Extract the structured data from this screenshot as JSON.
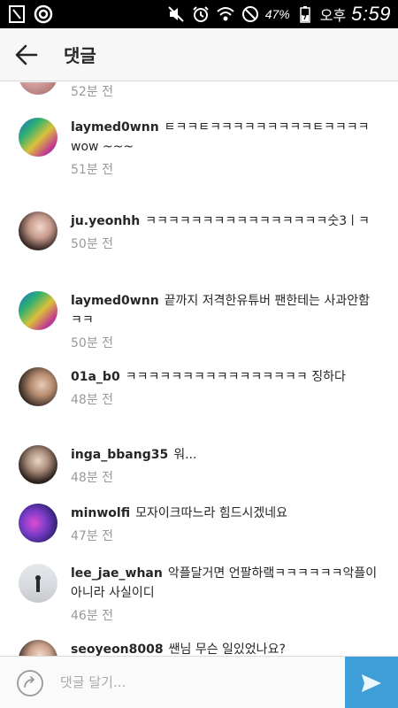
{
  "status_bar": {
    "battery_percent": "47%",
    "ampm": "오후",
    "time": "5:59"
  },
  "header": {
    "title": "댓글"
  },
  "partial_top_comment": {
    "time": "52분 전"
  },
  "comments": [
    {
      "username": "laymed0wnn",
      "text": "ㅌㅋㅋㅌㅋㅋㅋㅋㅋㅋㅋㅋㅋㅌㅋㅋㅋㅋ wow ~~~",
      "time": "51분 전"
    },
    {
      "username": "ju.yeonhh",
      "text": "ㅋㅋㅋㅋㅋㅋㅋㅋㅋㅋㅋㅋㅋㅋㅋㅋ숫3ㅣㅋ",
      "time": "50분 전"
    },
    {
      "username": "laymed0wnn",
      "text": "끝까지 저격한유튜버 팬한테는 사과안함 ㅋㅋ",
      "time": "50분 전"
    },
    {
      "username": "01a_b0",
      "text": "ㅋㅋㅋㅋㅋㅋㅋㅋㅋㅋㅋㅋㅋㅋㅋㅋ 징하다",
      "time": "48분 전"
    },
    {
      "username": "inga_bbang35",
      "text": "워...",
      "time": "48분 전"
    },
    {
      "username": "minwolfi",
      "text": "모자이크따느라 힘드시겠네요",
      "time": "47분 전"
    },
    {
      "username": "lee_jae_whan",
      "text": "악플달거면 언팔하랰ㅋㅋㅋㅋㅋㅋ악플이아니라 사실이디",
      "time": "46분 전"
    },
    {
      "username": "seoyeon8008",
      "text": "쌘님 무슨 일있었나요?",
      "time": ""
    }
  ],
  "compose": {
    "placeholder": "댓글 달기..."
  },
  "colors": {
    "status_bar_bg": "#000000",
    "header_bg": "#f7f7f7",
    "send_button_bg": "#3f9fd8",
    "timestamp": "#999999"
  }
}
